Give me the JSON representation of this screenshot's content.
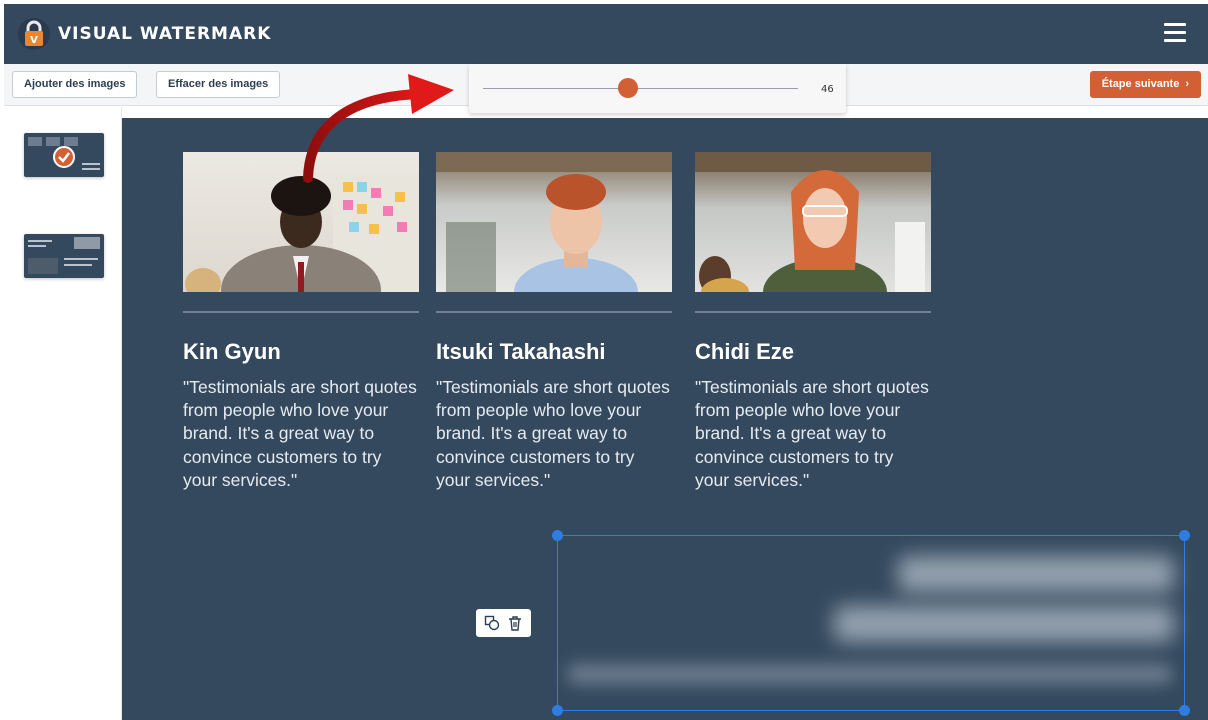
{
  "app": {
    "title": "VISUAL WATERMARK"
  },
  "toolbar": {
    "add_images": "Ajouter des images",
    "clear_images": "Effacer des images",
    "next_step": "Étape suivante"
  },
  "slider": {
    "value": "46",
    "fill_fraction": 0.46
  },
  "colors": {
    "header": "#34495e",
    "accent": "#d35f35",
    "selection": "#2f7de1"
  },
  "sidebar": {
    "thumbnails": [
      {
        "selected": true
      },
      {
        "selected": false
      }
    ]
  },
  "cards": [
    {
      "name": "Kin Gyun",
      "quote": "\"Testimonials are short quotes from people who love your brand. It's a great way to convince customers to try your services.\""
    },
    {
      "name": "Itsuki Takahashi",
      "quote": "\"Testimonials are short quotes from people who love your brand. It's a great way to convince customers to try your services.\""
    },
    {
      "name": "Chidi Eze",
      "quote": "\"Testimonials are short quotes from people who love your brand. It's a great way to convince customers to try your services.\""
    }
  ],
  "icons": {
    "menu": "hamburger-icon",
    "duplicate": "duplicate-icon",
    "delete": "trash-icon",
    "next": "chevron-right-icon",
    "logo": "padlock-icon"
  }
}
